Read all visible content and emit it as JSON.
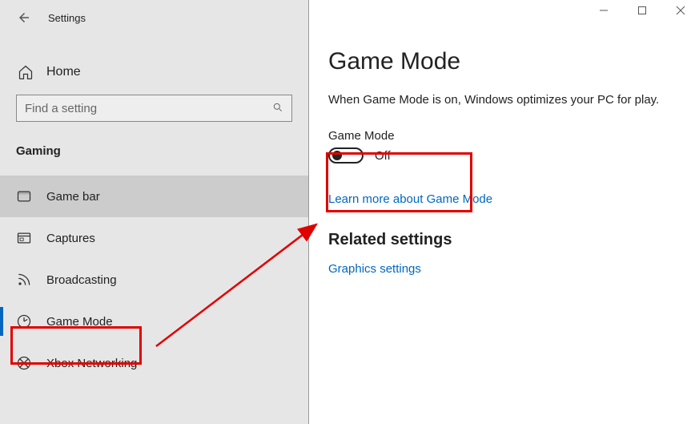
{
  "app": {
    "title": "Settings"
  },
  "sidebar": {
    "home_label": "Home",
    "search_placeholder": "Find a setting",
    "section": "Gaming",
    "items": [
      {
        "label": "Game bar",
        "icon": "gamebar"
      },
      {
        "label": "Captures",
        "icon": "captures"
      },
      {
        "label": "Broadcasting",
        "icon": "broadcasting"
      },
      {
        "label": "Game Mode",
        "icon": "gamemode"
      },
      {
        "label": "Xbox Networking",
        "icon": "xbox"
      }
    ]
  },
  "content": {
    "title": "Game Mode",
    "description": "When Game Mode is on, Windows optimizes your PC for play.",
    "toggle": {
      "label": "Game Mode",
      "state": "Off"
    },
    "learn_more": "Learn more about Game Mode",
    "related_heading": "Related settings",
    "graphics_link": "Graphics settings"
  }
}
